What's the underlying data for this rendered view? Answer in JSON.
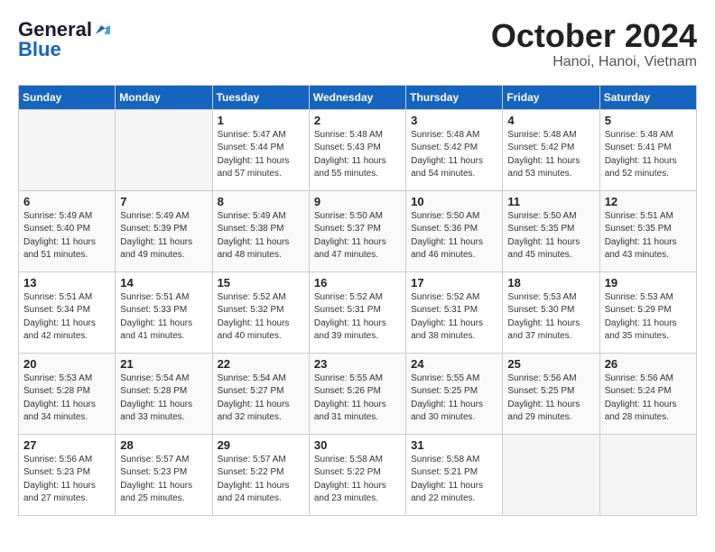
{
  "header": {
    "logo_general": "General",
    "logo_blue": "Blue",
    "month": "October 2024",
    "location": "Hanoi, Hanoi, Vietnam"
  },
  "days_of_week": [
    "Sunday",
    "Monday",
    "Tuesday",
    "Wednesday",
    "Thursday",
    "Friday",
    "Saturday"
  ],
  "weeks": [
    [
      {
        "day": "",
        "sunrise": "",
        "sunset": "",
        "daylight": ""
      },
      {
        "day": "",
        "sunrise": "",
        "sunset": "",
        "daylight": ""
      },
      {
        "day": "1",
        "sunrise": "Sunrise: 5:47 AM",
        "sunset": "Sunset: 5:44 PM",
        "daylight": "Daylight: 11 hours and 57 minutes."
      },
      {
        "day": "2",
        "sunrise": "Sunrise: 5:48 AM",
        "sunset": "Sunset: 5:43 PM",
        "daylight": "Daylight: 11 hours and 55 minutes."
      },
      {
        "day": "3",
        "sunrise": "Sunrise: 5:48 AM",
        "sunset": "Sunset: 5:42 PM",
        "daylight": "Daylight: 11 hours and 54 minutes."
      },
      {
        "day": "4",
        "sunrise": "Sunrise: 5:48 AM",
        "sunset": "Sunset: 5:42 PM",
        "daylight": "Daylight: 11 hours and 53 minutes."
      },
      {
        "day": "5",
        "sunrise": "Sunrise: 5:48 AM",
        "sunset": "Sunset: 5:41 PM",
        "daylight": "Daylight: 11 hours and 52 minutes."
      }
    ],
    [
      {
        "day": "6",
        "sunrise": "Sunrise: 5:49 AM",
        "sunset": "Sunset: 5:40 PM",
        "daylight": "Daylight: 11 hours and 51 minutes."
      },
      {
        "day": "7",
        "sunrise": "Sunrise: 5:49 AM",
        "sunset": "Sunset: 5:39 PM",
        "daylight": "Daylight: 11 hours and 49 minutes."
      },
      {
        "day": "8",
        "sunrise": "Sunrise: 5:49 AM",
        "sunset": "Sunset: 5:38 PM",
        "daylight": "Daylight: 11 hours and 48 minutes."
      },
      {
        "day": "9",
        "sunrise": "Sunrise: 5:50 AM",
        "sunset": "Sunset: 5:37 PM",
        "daylight": "Daylight: 11 hours and 47 minutes."
      },
      {
        "day": "10",
        "sunrise": "Sunrise: 5:50 AM",
        "sunset": "Sunset: 5:36 PM",
        "daylight": "Daylight: 11 hours and 46 minutes."
      },
      {
        "day": "11",
        "sunrise": "Sunrise: 5:50 AM",
        "sunset": "Sunset: 5:35 PM",
        "daylight": "Daylight: 11 hours and 45 minutes."
      },
      {
        "day": "12",
        "sunrise": "Sunrise: 5:51 AM",
        "sunset": "Sunset: 5:35 PM",
        "daylight": "Daylight: 11 hours and 43 minutes."
      }
    ],
    [
      {
        "day": "13",
        "sunrise": "Sunrise: 5:51 AM",
        "sunset": "Sunset: 5:34 PM",
        "daylight": "Daylight: 11 hours and 42 minutes."
      },
      {
        "day": "14",
        "sunrise": "Sunrise: 5:51 AM",
        "sunset": "Sunset: 5:33 PM",
        "daylight": "Daylight: 11 hours and 41 minutes."
      },
      {
        "day": "15",
        "sunrise": "Sunrise: 5:52 AM",
        "sunset": "Sunset: 5:32 PM",
        "daylight": "Daylight: 11 hours and 40 minutes."
      },
      {
        "day": "16",
        "sunrise": "Sunrise: 5:52 AM",
        "sunset": "Sunset: 5:31 PM",
        "daylight": "Daylight: 11 hours and 39 minutes."
      },
      {
        "day": "17",
        "sunrise": "Sunrise: 5:52 AM",
        "sunset": "Sunset: 5:31 PM",
        "daylight": "Daylight: 11 hours and 38 minutes."
      },
      {
        "day": "18",
        "sunrise": "Sunrise: 5:53 AM",
        "sunset": "Sunset: 5:30 PM",
        "daylight": "Daylight: 11 hours and 37 minutes."
      },
      {
        "day": "19",
        "sunrise": "Sunrise: 5:53 AM",
        "sunset": "Sunset: 5:29 PM",
        "daylight": "Daylight: 11 hours and 35 minutes."
      }
    ],
    [
      {
        "day": "20",
        "sunrise": "Sunrise: 5:53 AM",
        "sunset": "Sunset: 5:28 PM",
        "daylight": "Daylight: 11 hours and 34 minutes."
      },
      {
        "day": "21",
        "sunrise": "Sunrise: 5:54 AM",
        "sunset": "Sunset: 5:28 PM",
        "daylight": "Daylight: 11 hours and 33 minutes."
      },
      {
        "day": "22",
        "sunrise": "Sunrise: 5:54 AM",
        "sunset": "Sunset: 5:27 PM",
        "daylight": "Daylight: 11 hours and 32 minutes."
      },
      {
        "day": "23",
        "sunrise": "Sunrise: 5:55 AM",
        "sunset": "Sunset: 5:26 PM",
        "daylight": "Daylight: 11 hours and 31 minutes."
      },
      {
        "day": "24",
        "sunrise": "Sunrise: 5:55 AM",
        "sunset": "Sunset: 5:25 PM",
        "daylight": "Daylight: 11 hours and 30 minutes."
      },
      {
        "day": "25",
        "sunrise": "Sunrise: 5:56 AM",
        "sunset": "Sunset: 5:25 PM",
        "daylight": "Daylight: 11 hours and 29 minutes."
      },
      {
        "day": "26",
        "sunrise": "Sunrise: 5:56 AM",
        "sunset": "Sunset: 5:24 PM",
        "daylight": "Daylight: 11 hours and 28 minutes."
      }
    ],
    [
      {
        "day": "27",
        "sunrise": "Sunrise: 5:56 AM",
        "sunset": "Sunset: 5:23 PM",
        "daylight": "Daylight: 11 hours and 27 minutes."
      },
      {
        "day": "28",
        "sunrise": "Sunrise: 5:57 AM",
        "sunset": "Sunset: 5:23 PM",
        "daylight": "Daylight: 11 hours and 25 minutes."
      },
      {
        "day": "29",
        "sunrise": "Sunrise: 5:57 AM",
        "sunset": "Sunset: 5:22 PM",
        "daylight": "Daylight: 11 hours and 24 minutes."
      },
      {
        "day": "30",
        "sunrise": "Sunrise: 5:58 AM",
        "sunset": "Sunset: 5:22 PM",
        "daylight": "Daylight: 11 hours and 23 minutes."
      },
      {
        "day": "31",
        "sunrise": "Sunrise: 5:58 AM",
        "sunset": "Sunset: 5:21 PM",
        "daylight": "Daylight: 11 hours and 22 minutes."
      },
      {
        "day": "",
        "sunrise": "",
        "sunset": "",
        "daylight": ""
      },
      {
        "day": "",
        "sunrise": "",
        "sunset": "",
        "daylight": ""
      }
    ]
  ]
}
